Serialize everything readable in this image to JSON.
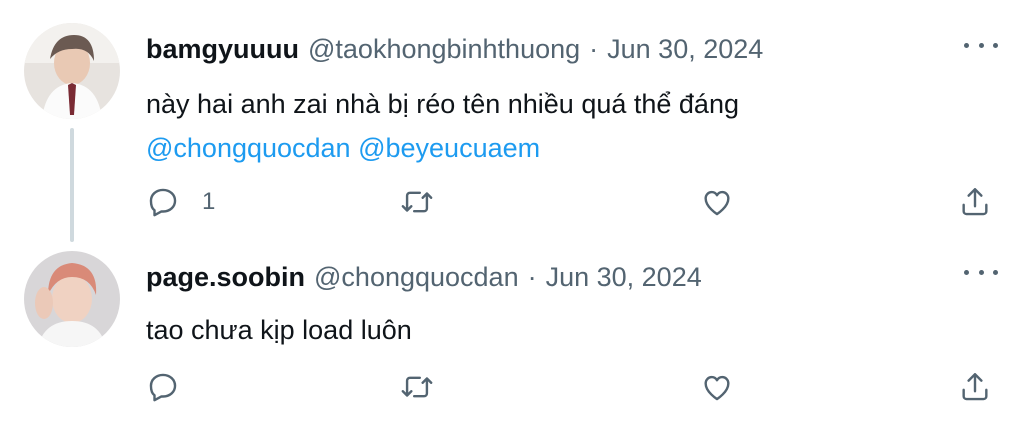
{
  "tweets": [
    {
      "display_name": "bamgyuuuu",
      "handle": "@taokhongbinhthuong",
      "separator": "·",
      "date": "Jun 30, 2024",
      "text_line1": "này hai anh zai nhà bị réo tên nhiều quá thể đáng",
      "mentions": [
        "@chongquocdan",
        "@beyeucuaem"
      ],
      "reply_count": "1",
      "avatar_icon": "profile-photo",
      "has_thread_line": true
    },
    {
      "display_name": "page.soobin",
      "handle": "@chongquocdan",
      "separator": "·",
      "date": "Jun 30, 2024",
      "text_line1": "tao chưa kịp load luôn",
      "reply_count": "",
      "avatar_icon": "profile-photo"
    }
  ],
  "icons": {
    "reply": "reply-icon",
    "retweet": "retweet-icon",
    "like": "like-icon",
    "share": "share-icon",
    "more": "more-icon"
  },
  "colors": {
    "text": "#0f1419",
    "secondary": "#536471",
    "mention": "#1d9bf0",
    "thread_line": "#cfd9de"
  }
}
